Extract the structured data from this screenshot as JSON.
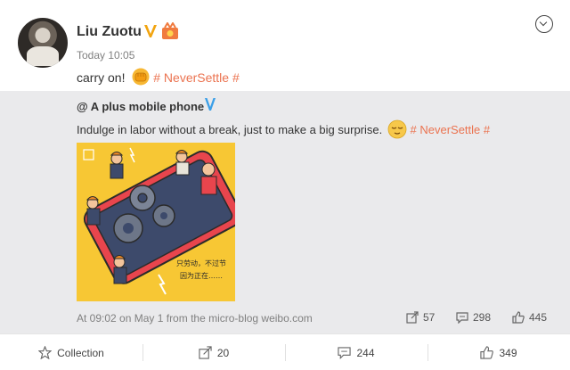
{
  "post": {
    "author": "Liu Zuotu",
    "time": "Today 10:05",
    "text": "carry on!",
    "tag": "# NeverSettle #"
  },
  "repost": {
    "author": "@ A plus mobile phone",
    "text": "Indulge in labor without a break, just to make a big surprise.",
    "tag": "# NeverSettle #",
    "image_caption_line1": "只劳动，不过节",
    "image_caption_line2": "因为正在……",
    "meta": "At 09:02 on May 1 from the micro-blog weibo.com",
    "stats": {
      "reposts": "57",
      "comments": "298",
      "likes": "445"
    }
  },
  "footer": {
    "collection_label": "Collection",
    "reposts": "20",
    "comments": "244",
    "likes": "349"
  },
  "colors": {
    "tag": "#eb7350",
    "verified": "#f2a40f",
    "repost_bg": "#eaeaec",
    "illustration_bg": "#f7c734"
  }
}
